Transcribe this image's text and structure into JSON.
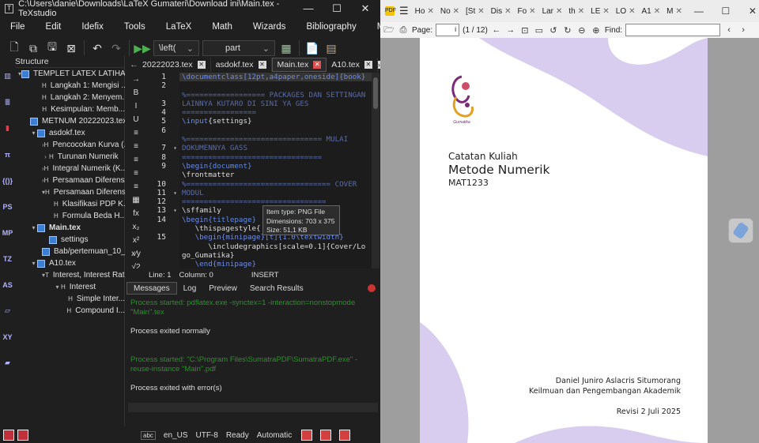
{
  "texstudio": {
    "title": "C:\\Users\\danie\\Downloads\\LaTeX Gumateri\\Download ini\\Main.tex - TeXstudio",
    "window_controls": [
      "—",
      "☐",
      "✕"
    ],
    "menu": [
      "File",
      "Edit",
      "Idefix",
      "Tools",
      "LaTeX",
      "Math",
      "Wizards",
      "Bibliography",
      "Macros"
    ],
    "toolbar": {
      "left_combo": "\\left(",
      "part_combo": "part"
    },
    "rail": [
      "",
      "",
      "",
      "π",
      "{()}",
      "PS",
      "MP",
      "TZ",
      "AS",
      "",
      "XY",
      ""
    ],
    "structure": {
      "header": "Structure",
      "items": [
        {
          "label": "TEMPLET LATEX LATIHAN...",
          "level": 0,
          "icon": "doc",
          "arrow": "▾"
        },
        {
          "label": "Langkah 1: Mengisi ...",
          "level": 2,
          "icon": "H",
          "arrow": ""
        },
        {
          "label": "Langkah 2: Menyem...",
          "level": 2,
          "icon": "H",
          "arrow": ""
        },
        {
          "label": "Kesimpulan: Memb...",
          "level": 2,
          "icon": "H",
          "arrow": ""
        },
        {
          "label": "METNUM 20222023.tex",
          "level": 1,
          "icon": "doc",
          "arrow": ""
        },
        {
          "label": "asdokf.tex",
          "level": 1,
          "icon": "doc",
          "arrow": "▾"
        },
        {
          "label": "Pencocokan Kurva (...",
          "level": 2,
          "icon": "H",
          "arrow": "›"
        },
        {
          "label": "Turunan Numerik",
          "level": 2,
          "icon": "H",
          "arrow": "›"
        },
        {
          "label": "Integral Numerik (K...",
          "level": 2,
          "icon": "H",
          "arrow": "›"
        },
        {
          "label": "Persamaan Diferensi...",
          "level": 2,
          "icon": "H",
          "arrow": "›"
        },
        {
          "label": "Persamaan Diferensi...",
          "level": 2,
          "icon": "H",
          "arrow": "▾"
        },
        {
          "label": "Klasifikasi PDP K...",
          "level": 3,
          "icon": "H",
          "arrow": ""
        },
        {
          "label": "Formula Beda H...",
          "level": 3,
          "icon": "H",
          "arrow": ""
        },
        {
          "label": "Main.tex",
          "level": 1,
          "icon": "doc",
          "arrow": "▾",
          "bold": true
        },
        {
          "label": "settings",
          "level": 2,
          "icon": "doc",
          "arrow": ""
        },
        {
          "label": "Bab/pertemuan_10_...",
          "level": 2,
          "icon": "doc",
          "arrow": ""
        },
        {
          "label": "A10.tex",
          "level": 1,
          "icon": "doc",
          "arrow": "▾"
        },
        {
          "label": "Interest, Interest Rat...",
          "level": 2,
          "icon": "T",
          "arrow": "▾"
        },
        {
          "label": "Interest",
          "level": 3,
          "icon": "H",
          "arrow": "▾"
        },
        {
          "label": "Simple Inter...",
          "level": 4,
          "icon": "H",
          "arrow": ""
        },
        {
          "label": "Compound I...",
          "level": 4,
          "icon": "H",
          "arrow": ""
        }
      ]
    },
    "tabs": [
      {
        "label": "20222023.tex",
        "active": false
      },
      {
        "label": "asdokf.tex",
        "active": false
      },
      {
        "label": "Main.tex",
        "active": true
      },
      {
        "label": "A10.tex",
        "active": false
      }
    ],
    "editor_tools": [
      "→",
      "B",
      "I",
      "U",
      "≡",
      "≡",
      "≡",
      "≡",
      "≡",
      "▦",
      "fx",
      "x₂",
      "x²",
      "x⁄y",
      "√2"
    ],
    "line_numbers": [
      "1",
      "2",
      "",
      "3",
      "4",
      "5",
      "6",
      "",
      "7",
      "8",
      "9",
      "",
      "10",
      "11",
      "12",
      "13",
      "14",
      "",
      "15"
    ],
    "fold_markers": [
      "",
      "",
      "",
      "",
      "",
      "",
      "",
      "",
      "▾",
      "",
      "",
      "",
      "",
      "▾",
      "",
      "▾",
      "",
      "",
      ""
    ],
    "code_lines": [
      [
        {
          "t": "\\documentclass[12pt,a4paper,oneside]{book}",
          "c": "kw"
        }
      ],
      [
        {
          "t": "",
          "c": "tx"
        }
      ],
      [
        {
          "t": "%================== PACKAGES DAN SETTINGAN",
          "c": "cm"
        }
      ],
      [
        {
          "t": "LAINNYA KUTARO DI SINI YA GES",
          "c": "cm"
        }
      ],
      [
        {
          "t": "=================",
          "c": "cm"
        }
      ],
      [
        {
          "t": "\\input",
          "c": "kw"
        },
        {
          "t": "{settings}",
          "c": "tx"
        }
      ],
      [
        {
          "t": "",
          "c": "tx"
        }
      ],
      [
        {
          "t": "%=============================== MULAI",
          "c": "cm"
        }
      ],
      [
        {
          "t": "DOKUMENNYA GASS",
          "c": "cm"
        }
      ],
      [
        {
          "t": "================================",
          "c": "cm"
        }
      ],
      [
        {
          "t": "\\begin",
          "c": "kw"
        },
        {
          "t": "{document}",
          "c": "br"
        }
      ],
      [
        {
          "t": "\\frontmatter",
          "c": "tx"
        }
      ],
      [
        {
          "t": "%================================= COVER",
          "c": "cm"
        }
      ],
      [
        {
          "t": "MODUL",
          "c": "cm"
        }
      ],
      [
        {
          "t": "=================================",
          "c": "cm"
        }
      ],
      [
        {
          "t": "\\sffamily",
          "c": "tx"
        }
      ],
      [
        {
          "t": "\\begin",
          "c": "kw"
        },
        {
          "t": "{titlepage}",
          "c": "br"
        }
      ],
      [
        {
          "t": "   \\thispagestyle{",
          "c": "tx"
        }
      ],
      [
        {
          "t": "   \\begin{minipage}[t]{1.0\\textwidth}",
          "c": "kw"
        }
      ],
      [
        {
          "t": "      \\includegraphics[scale=0.1]{Cover/Lo",
          "c": "tx"
        }
      ],
      [
        {
          "t": "go_Gumatika}",
          "c": "tx"
        }
      ],
      [
        {
          "t": "   \\end{minipage}",
          "c": "kw"
        }
      ]
    ],
    "tooltip": {
      "line1": "Item type: PNG File",
      "line2": "Dimensions: 703 x 375",
      "line3": "Size: 51,1 KB"
    },
    "cursor_status": {
      "line": "Line: 1",
      "column": "Column: 0",
      "mode": "INSERT"
    },
    "message_tabs": [
      "Messages",
      "Log",
      "Preview",
      "Search Results"
    ],
    "messages": [
      {
        "text": "Process started: pdflatex.exe -synctex=1 -interaction=nonstopmode \"Main\".tex",
        "color": "green"
      },
      {
        "text": "Process exited normally",
        "color": "white"
      },
      {
        "text": "Process started: \"C:\\Program Files\\SumatraPDF\\SumatraPDF.exe\" -reuse-instance \"Main\".pdf",
        "color": "green"
      },
      {
        "text": "Process exited with error(s)",
        "color": "white"
      }
    ],
    "status_bar": {
      "spell": "abc",
      "language": "en_US",
      "encoding": "UTF-8",
      "ready": "Ready",
      "mode": "Automatic"
    }
  },
  "sumatra": {
    "tabs": [
      "Ho",
      "No",
      "[St",
      "Dis",
      "Fo",
      "Lar",
      "th",
      "LE",
      "LO",
      "A1",
      "M"
    ],
    "page_label": "Page:",
    "page_input": "i",
    "page_count": "(1 / 12)",
    "find_label": "Find:",
    "find_value": "",
    "logo_caption": "Gumatika",
    "document": {
      "subtitle": "Catatan Kuliah",
      "title": "Metode Numerik",
      "code": "MAT1233",
      "author": "Daniel Juniro Aslacris Situmorang",
      "department": "Keilmuan dan Pengembangan Akademik",
      "revision": "Revisi 2 Juli 2025"
    },
    "accent_color": "#d9cdef"
  }
}
